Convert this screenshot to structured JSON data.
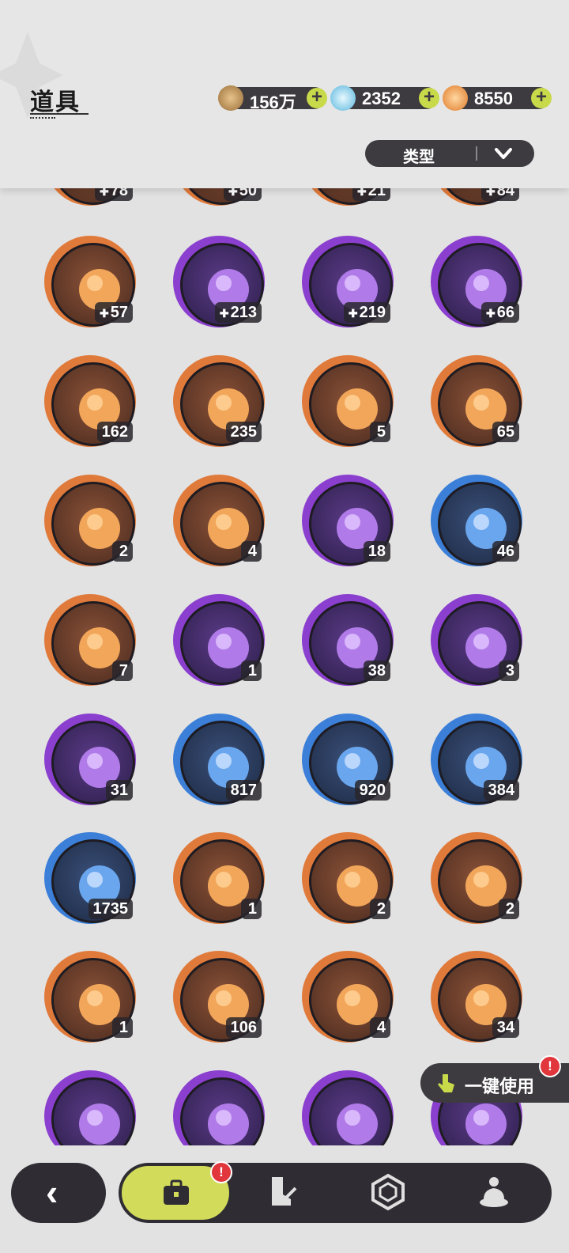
{
  "header": {
    "title": "道具",
    "filter_label": "类型"
  },
  "currencies": [
    {
      "name": "gold-coin",
      "value": "156万",
      "color": "#c69a5a"
    },
    {
      "name": "crystal",
      "value": "2352",
      "color": "#7fd0e8"
    },
    {
      "name": "star-shard",
      "value": "8550",
      "color": "#e8903a"
    }
  ],
  "items": [
    {
      "rarity": "orange",
      "count": "78",
      "frag": true
    },
    {
      "rarity": "orange",
      "count": "50",
      "frag": true
    },
    {
      "rarity": "orange",
      "count": "21",
      "frag": true
    },
    {
      "rarity": "orange",
      "count": "84",
      "frag": true
    },
    {
      "rarity": "orange",
      "count": "57",
      "frag": true,
      "icon": "cat-fragment"
    },
    {
      "rarity": "purple",
      "count": "213",
      "frag": true,
      "icon": "tanuki-fragment"
    },
    {
      "rarity": "purple",
      "count": "219",
      "frag": true,
      "icon": "bear-fragment"
    },
    {
      "rarity": "purple",
      "count": "66",
      "frag": true,
      "icon": "duck-fragment"
    },
    {
      "rarity": "orange",
      "count": "162",
      "icon": "pink-crystal"
    },
    {
      "rarity": "orange",
      "count": "235",
      "icon": "blue-crystal"
    },
    {
      "rarity": "orange",
      "count": "5",
      "icon": "paw-charm-red"
    },
    {
      "rarity": "orange",
      "count": "65",
      "icon": "paw-charm-gold"
    },
    {
      "rarity": "orange",
      "count": "2",
      "icon": "character-card-rainbow"
    },
    {
      "rarity": "orange",
      "count": "4",
      "icon": "character-card-gold"
    },
    {
      "rarity": "purple",
      "count": "18",
      "icon": "character-card-purple"
    },
    {
      "rarity": "blue",
      "count": "46",
      "icon": "character-card-blue"
    },
    {
      "rarity": "orange",
      "count": "7",
      "icon": "clover-card"
    },
    {
      "rarity": "purple",
      "count": "1",
      "icon": "gift-box"
    },
    {
      "rarity": "purple",
      "count": "38",
      "icon": "golden-bell"
    },
    {
      "rarity": "purple",
      "count": "3",
      "icon": "scroll"
    },
    {
      "rarity": "purple",
      "count": "31",
      "icon": "apple"
    },
    {
      "rarity": "blue",
      "count": "817",
      "icon": "shovel"
    },
    {
      "rarity": "blue",
      "count": "920",
      "icon": "glove"
    },
    {
      "rarity": "blue",
      "count": "384",
      "icon": "pickaxe"
    },
    {
      "rarity": "blue",
      "count": "1735",
      "icon": "hammer"
    },
    {
      "rarity": "orange",
      "count": "1",
      "icon": "green-cloud"
    },
    {
      "rarity": "orange",
      "count": "2",
      "icon": "spiked-ball"
    },
    {
      "rarity": "orange",
      "count": "2",
      "icon": "potion"
    },
    {
      "rarity": "orange",
      "count": "1",
      "icon": "golden-key"
    },
    {
      "rarity": "orange",
      "count": "106",
      "icon": "heart-gem"
    },
    {
      "rarity": "orange",
      "count": "4",
      "icon": "shirt-coin"
    },
    {
      "rarity": "orange",
      "count": "34",
      "icon": "wheel-ticket"
    },
    {
      "rarity": "purple",
      "count": "",
      "icon": "gold-coin"
    },
    {
      "rarity": "purple",
      "count": "",
      "icon": "star-coin"
    },
    {
      "rarity": "purple",
      "count": "",
      "icon": "fist-coin"
    },
    {
      "rarity": "purple",
      "count": "",
      "icon": "ice-coin"
    }
  ],
  "one_key_use": {
    "label": "一键使用",
    "badge": "!"
  },
  "bottom_nav": {
    "back": "‹",
    "bag_badge": "!",
    "tabs": [
      "bag-icon",
      "boot-sword-icon",
      "hexagon-gem-icon",
      "cream-icon"
    ]
  },
  "colors": {
    "accent": "#d3dc5a",
    "dark": "#2f2d33",
    "orange": "#e07a3b",
    "purple": "#8b3fcf",
    "blue": "#3b7fd8"
  }
}
